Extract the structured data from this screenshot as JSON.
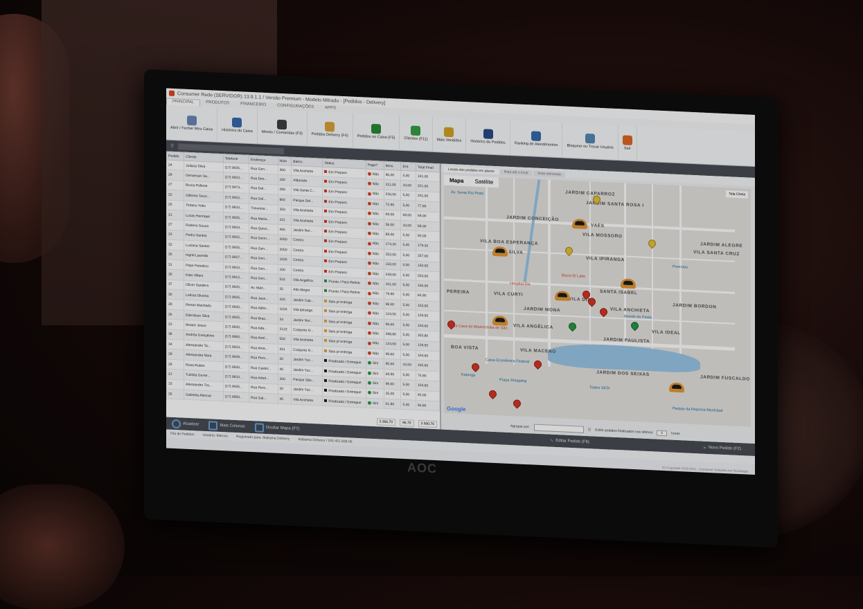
{
  "window": {
    "title": "Consumer Rede (SERVIDOR) 13.9.1.1 / Versão Premium - Modelo Mitrado - [Pedidos - Delivery]"
  },
  "menu": [
    "PRINCIPAL",
    "PRODUTOS",
    "FINANCEIRO",
    "CONFIGURAÇÕES",
    "APPS"
  ],
  "ribbon": {
    "items": [
      {
        "label": "Abrir / Fechar Meu Caixa",
        "color": "#6b8bb5"
      },
      {
        "label": "Histórico do Caixa",
        "color": "#3a6db0"
      },
      {
        "label": "Mesas / Comandas (F3)",
        "color": "#444"
      },
      {
        "label": "Pedidos Delivery (F4)",
        "color": "#d9a43a"
      },
      {
        "label": "Pedidos no Caixa (F5)",
        "color": "#2e8d3a"
      },
      {
        "label": "Clientes (F11)",
        "color": "#3aa14a"
      },
      {
        "label": "Mais Vendidos",
        "color": "#d4a32a"
      },
      {
        "label": "Histórico de Pedidos",
        "color": "#2e4f8a"
      },
      {
        "label": "Ranking de Atendimentos",
        "color": "#3a6db0"
      },
      {
        "label": "Bloquear ou Trocar Usuário",
        "color": "#5a8ab5"
      },
      {
        "label": "Sair",
        "color": "#e06a2a"
      }
    ],
    "groups": [
      "Caixa",
      "Vendas",
      "Clientes",
      "Relatórios",
      "Sair"
    ]
  },
  "search": {
    "placeholder": "Procurar por..."
  },
  "table": {
    "headers": [
      "Pedido",
      "Cliente",
      "Telefone",
      "Endereço",
      "Núm",
      "Bairro",
      "Status",
      "Pago?",
      "Itens",
      "Ent.",
      "Total Final"
    ],
    "rows": [
      [
        "24",
        "Juliana Silva",
        "(17) 9925...",
        "Rua Gen...",
        "400",
        "Vila Anchieta",
        "Em Preparo",
        "red",
        "Não",
        "96,00",
        "5,00",
        "101,00"
      ],
      [
        "29",
        "Genuevan Sa...",
        "(17) 9923...",
        "Rua Des...",
        "180",
        "Aldorado",
        "Em Preparo",
        "red",
        "Não",
        "211,00",
        "10,00",
        "221,00"
      ],
      [
        "27",
        "Bruno Pollone",
        "(17) 9974...",
        "Rua Dal...",
        "290",
        "Vila Santa C...",
        "Em Preparo",
        "red",
        "Não",
        "236,00",
        "5,00",
        "241,00"
      ],
      [
        "22",
        "Gilberto Tonzi...",
        "(17) 9923...",
        "Rua Gel...",
        "800",
        "Parque Del...",
        "Em Preparo",
        "red",
        "Não",
        "72,90",
        "5,00",
        "77,90"
      ],
      [
        "25",
        "Tintano Yoko",
        "(17) 9810...",
        "Travessa...",
        "350",
        "Vila Anchieta",
        "Em Preparo",
        "red",
        "Não",
        "69,00",
        "69,00",
        "69,00"
      ],
      [
        "21",
        "Lucas Henrique",
        "(17) 9925...",
        "Rua Maria...",
        "321",
        "Vila Anchieta",
        "Em Preparo",
        "red",
        "Não",
        "58,00",
        "10,00",
        "68,00"
      ],
      [
        "27",
        "Rubens Souza",
        "(17) 9924...",
        "Rua Quinz...",
        "465",
        "Jardim Nor...",
        "Em Preparo",
        "red",
        "Não",
        "89,00",
        "5,00",
        "94,00"
      ],
      [
        "33",
        "Pedro Santos",
        "(17) 9922...",
        "Rua Genn...",
        "2050",
        "Centro",
        "Em Preparo",
        "red",
        "Não",
        "174,30",
        "5,00",
        "179,30"
      ],
      [
        "32",
        "Luciana Santos",
        "(17) 9925...",
        "Rua Gen...",
        "2050",
        "Centro",
        "Em Preparo",
        "red",
        "Não",
        "352,00",
        "5,00",
        "357,00"
      ],
      [
        "35",
        "Ingrid Lacerda",
        "(17) 9927...",
        "Rua Gen...",
        "1025",
        "Centro",
        "Em Preparo",
        "red",
        "Não",
        "150,00",
        "0,00",
        "150,00"
      ],
      [
        "31",
        "Pepe Petrolino",
        "(17) 9910...",
        "Rua Gen...",
        "100",
        "Centro",
        "Em Preparo",
        "red",
        "Não",
        "249,00",
        "5,00",
        "254,00"
      ],
      [
        "35",
        "Kato Villars",
        "(17) 9912...",
        "Rua Gen...",
        "532",
        "Vila Angélica",
        "Pronto / Para Retirar",
        "red",
        "Não",
        "101,00",
        "5,00",
        "106,00"
      ],
      [
        "37",
        "Oliver Sanders",
        "(17) 9925...",
        "Av. Mári...",
        "25",
        "Alto Alegre",
        "Pronto / Para Retirar",
        "red",
        "Não",
        "79,90",
        "5,00",
        "84,90"
      ],
      [
        "30",
        "Letícia Oliveira",
        "(17) 9925...",
        "Rua Jaus...",
        "420",
        "Jardim Cap...",
        "Saiu p/ entrega",
        "red",
        "Não",
        "98,00",
        "5,00",
        "103,00"
      ],
      [
        "28",
        "Renan Machado",
        "(17) 9920...",
        "Rua Adhe...",
        "1024",
        "Vila Ipiranga",
        "Saiu p/ entrega",
        "red",
        "Não",
        "124,50",
        "5,00",
        "129,50"
      ],
      [
        "26",
        "Edenilson Silva",
        "(17) 9925...",
        "Rua Bras...",
        "34",
        "Jardim Nor...",
        "Saiu p/ entrega",
        "red",
        "Não",
        "99,60",
        "5,00",
        "104,60"
      ],
      [
        "23",
        "Moacir Jesus",
        "(17) 9920...",
        "Rua Ada...",
        "2122",
        "Conjunto H...",
        "Saiu p/ entrega",
        "red",
        "Não",
        "298,80",
        "5,00",
        "303,80"
      ],
      [
        "38",
        "Andréa Gonçalves",
        "(17) 9983...",
        "Rua Anel...",
        "550",
        "Vila Anchieta",
        "Saiu p/ entrega",
        "red",
        "Não",
        "124,50",
        "5,00",
        "129,50"
      ],
      [
        "34",
        "Alessandro Ta...",
        "(17) 9924...",
        "Rua Ama...",
        "261",
        "Conjunto H...",
        "Saiu p/ entrega",
        "red",
        "Não",
        "99,60",
        "5,00",
        "104,60"
      ],
      [
        "39",
        "Alessandra Nara",
        "(17) 9929...",
        "Rua Pers...",
        "20",
        "Jardim Yuc...",
        "Finalizado / Entregue",
        "green",
        "Sim",
        "95,60",
        "10,00",
        "105,60"
      ],
      [
        "29",
        "Rosa Rubes",
        "(17) 9926...",
        "Rua Castel...",
        "40",
        "Jardim Yuc...",
        "Finalizado / Entregue",
        "green",
        "Sim",
        "69,90",
        "5,00",
        "74,90"
      ],
      [
        "21",
        "Tubista Gurse...",
        "(17) 9810...",
        "Rua Arbel...",
        "300",
        "Parque São...",
        "Finalizado / Entregue",
        "green",
        "Sim",
        "99,60",
        "5,00",
        "104,60"
      ],
      [
        "15",
        "Alessandro Tra...",
        "(17) 9925...",
        "Rua Pers...",
        "20",
        "Jardim Yuc...",
        "Finalizado / Entregue",
        "green",
        "Sim",
        "35,00",
        "5,00",
        "40,00"
      ],
      [
        "25",
        "Gabriela Alencar",
        "(17) 9950...",
        "Rua Gal...",
        "45",
        "Vila Anchieta",
        "Finalizado / Entregue",
        "green",
        "Sim",
        "61,80",
        "5,00",
        "66,80"
      ]
    ],
    "totals": [
      "3.366,70",
      "96,70",
      "3.500,70"
    ]
  },
  "right_header": {
    "edit": "Editar Pedido (F6)",
    "new": "Novo Pedido (F2)"
  },
  "map_tabs": [
    "Locais dos pedidos em aberto",
    "Rota até o local",
    "Rota otimizada"
  ],
  "map": {
    "type_map": "Mapa",
    "type_sat": "Satélite",
    "fullscreen": "Tela Cheia",
    "neighborhoods": [
      "JARDIM CAPARROZ",
      "JARDIM SANTA ROSA I",
      "JARDIM CONCEIÇÃO",
      "VAES",
      "VILA MOSSORO",
      "VILA BOA ESPERANÇA",
      "JOÃO SILVA",
      "VILA IPIRANGA",
      "VILA ANCHIETA",
      "PEREIRA",
      "VILA CURTI",
      "SANTA ISABEL",
      "VILA DIAS",
      "JARDIM MONA",
      "JARDIM BORDON",
      "VILA ANGÉLICA",
      "VILA IDEAL",
      "JARDIM PAULISTA",
      "BOA VISTA",
      "VILA MACENO",
      "JARDIM DOS SEIXAS",
      "JARDIM FUSCALDO",
      "VILA SANTA CRUZ",
      "JARDIM ALEGRE"
    ],
    "pois": [
      "Hospital Dia",
      "Bacio Di Latte",
      "Porecatu",
      "Mundo do Festa",
      "Santa Casa de Misericórdia de São",
      "Caixa Econômica Federal",
      "Praça Shopping",
      "Kalunga",
      "Teatro SESI",
      "Parque da Represa Municipal",
      "Av. Senai Rio Preto"
    ],
    "pin_colors": {
      "red": "#d83a2a",
      "green": "#2e9a4a",
      "yellow": "#e3c33a",
      "orange": "#e49a3a"
    }
  },
  "map_footer": {
    "group_label": "Agrupar por:",
    "show_finalized": "Exibir pedidos finalizados nos últimos",
    "value": "6",
    "unit": "horas"
  },
  "bottom_left": {
    "refresh": "Atualizar",
    "more_cols": "Mais Colunas",
    "hide_map": "Ocultar Mapa (F7)"
  },
  "status": {
    "queue": "Fila de Pedidos",
    "user": "Usuário: Marcos",
    "registered": "Registrado para: Alabama Delivery",
    "license": "Alabama Delivery / 205.451.928-06",
    "copyright": "(C) Copyright 2016-2021 - Consumer Soluções em Tecnologia"
  },
  "monitor_brand": "AOC"
}
